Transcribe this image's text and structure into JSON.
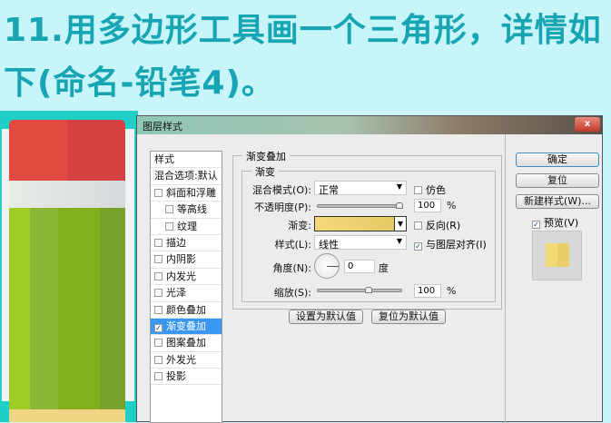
{
  "heading": {
    "line1": "11.用多边形工具画一个三角形，详情如",
    "line2": "下(命名-铅笔4)。"
  },
  "dialog": {
    "title": "图层样式",
    "close": "x",
    "styles_list": [
      {
        "label": "样式",
        "check": null
      },
      {
        "label": "混合选项:默认",
        "check": null
      },
      {
        "label": "斜面和浮雕",
        "check": false
      },
      {
        "label": "等高线",
        "check": false,
        "sub": true
      },
      {
        "label": "纹理",
        "check": false,
        "sub": true
      },
      {
        "label": "描边",
        "check": false
      },
      {
        "label": "内阴影",
        "check": false
      },
      {
        "label": "内发光",
        "check": false
      },
      {
        "label": "光泽",
        "check": false
      },
      {
        "label": "颜色叠加",
        "check": false
      },
      {
        "label": "渐变叠加",
        "check": true,
        "active": true
      },
      {
        "label": "图案叠加",
        "check": false
      },
      {
        "label": "外发光",
        "check": false
      },
      {
        "label": "投影",
        "check": false
      }
    ],
    "section_title": "渐变叠加",
    "group_title": "渐变",
    "blend_mode_label": "混合模式(O):",
    "blend_mode": "正常",
    "dither_label": "仿色",
    "opacity_label": "不透明度(P):",
    "opacity": "100",
    "opacity_unit": "%",
    "gradient_label": "渐变:",
    "gradient_colors": [
      "#f4d97a",
      "#e8cd6a"
    ],
    "reverse_label": "反向(R)",
    "style_label": "样式(L):",
    "style": "线性",
    "align_label": "与图层对齐(I)",
    "angle_label": "角度(N):",
    "angle": "0",
    "angle_unit": "度",
    "scale_label": "缩放(S):",
    "scale": "100",
    "scale_unit": "%",
    "set_default": "设置为默认值",
    "reset_default": "复位为默认值",
    "ok": "确定",
    "reset": "复位",
    "new_style": "新建样式(W)...",
    "preview_label": "预览(V)"
  }
}
